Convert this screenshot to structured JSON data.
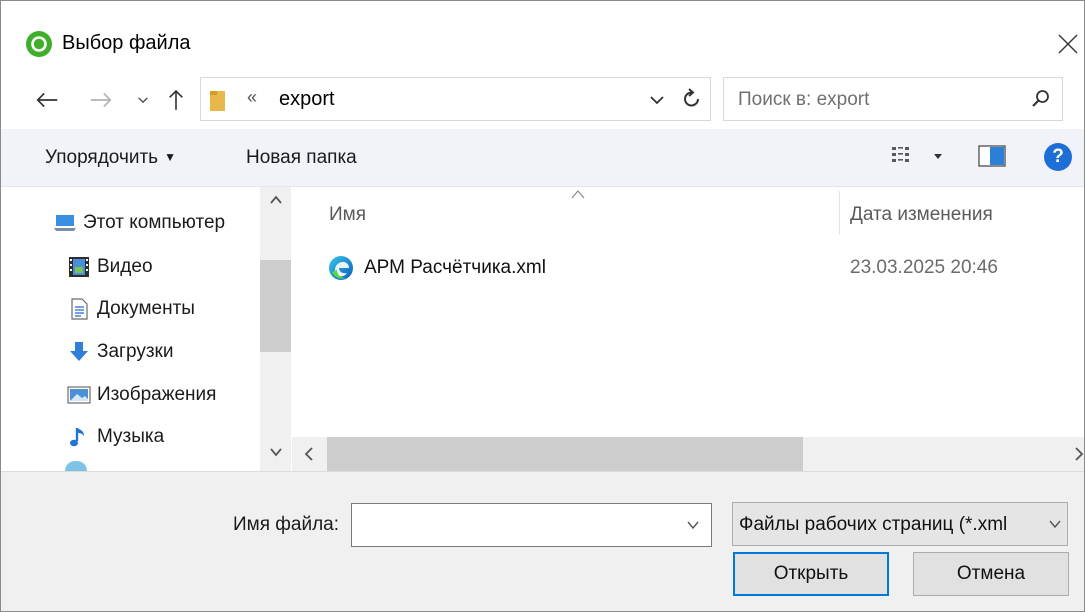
{
  "window": {
    "title": "Выбор файла"
  },
  "nav": {
    "address_chevron": "«",
    "address_path": "export",
    "search_placeholder": "Поиск в: export"
  },
  "toolbar": {
    "organize_label": "Упорядочить",
    "new_folder_label": "Новая папка",
    "help_label": "?"
  },
  "tree": {
    "items": [
      {
        "label": "Этот компьютер",
        "icon": "computer-icon"
      },
      {
        "label": "Видео",
        "icon": "video-icon"
      },
      {
        "label": "Документы",
        "icon": "documents-icon"
      },
      {
        "label": "Загрузки",
        "icon": "downloads-icon"
      },
      {
        "label": "Изображения",
        "icon": "pictures-icon"
      },
      {
        "label": "Музыка",
        "icon": "music-icon"
      }
    ]
  },
  "list": {
    "columns": {
      "name": "Имя",
      "date": "Дата изменения"
    },
    "files": [
      {
        "name": "АРМ Расчётчика.xml",
        "date": "23.03.2025 20:46",
        "icon": "edge-icon"
      }
    ]
  },
  "bottom": {
    "filename_label": "Имя файла:",
    "filename_value": "",
    "filter_value": "Файлы рабочих страниц (*.xml",
    "open_label": "Открыть",
    "cancel_label": "Отмена"
  },
  "colors": {
    "accent": "#0078d7",
    "toolbar_bg": "#f1f3f8",
    "panel_bg": "#f0f0f0",
    "app_green": "#3fae2a"
  }
}
